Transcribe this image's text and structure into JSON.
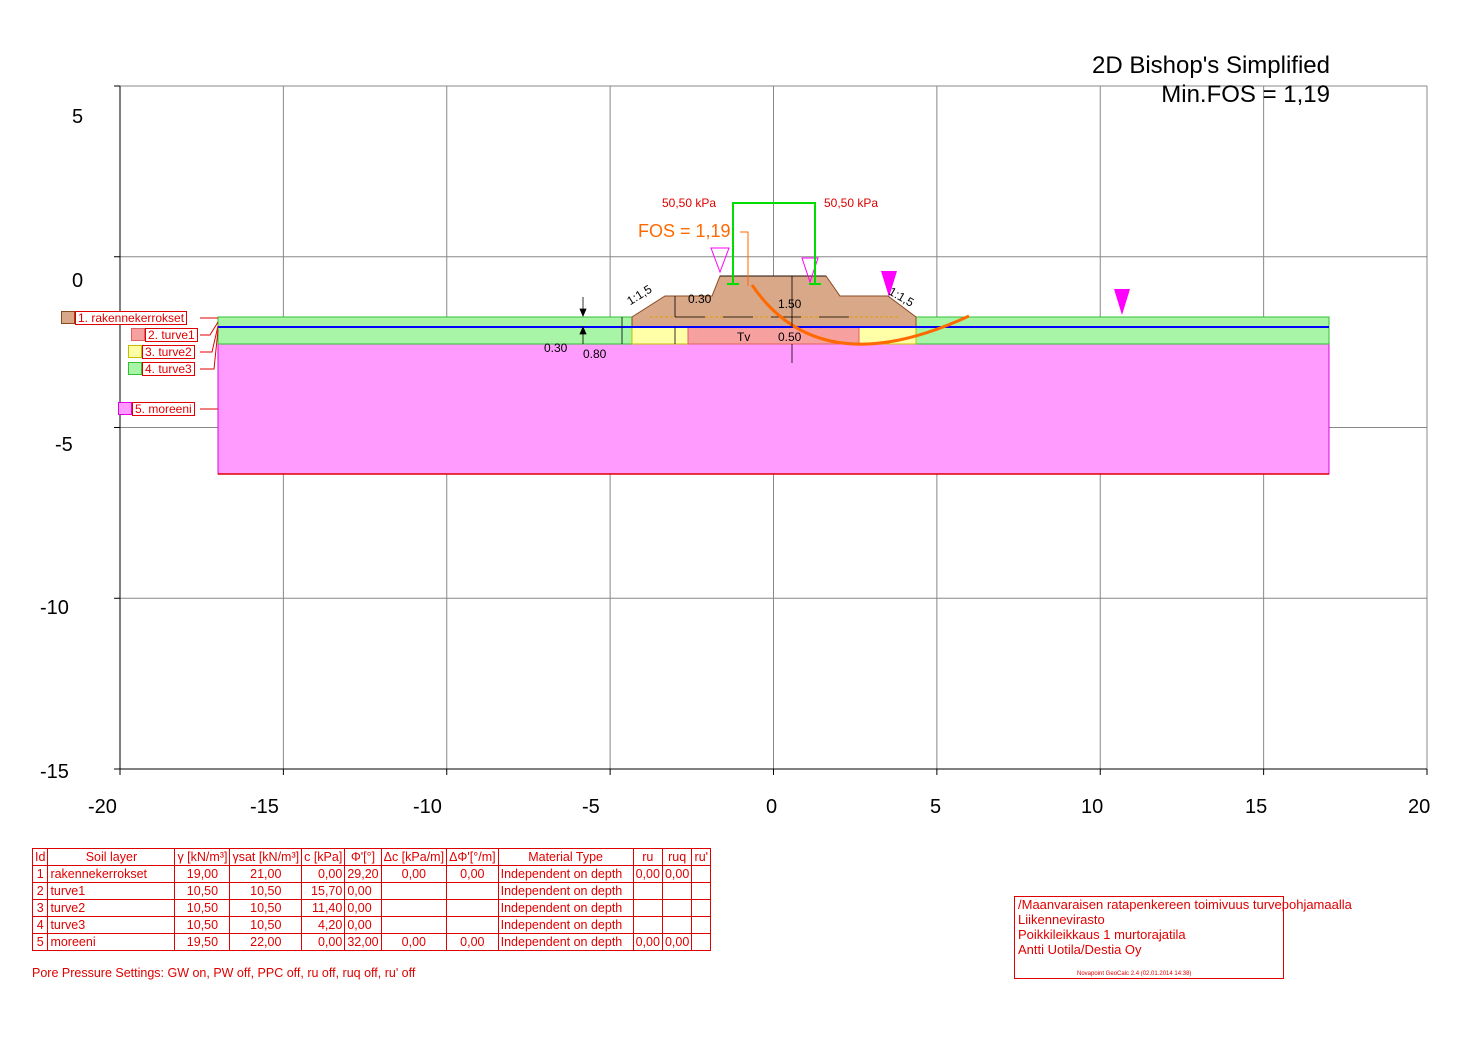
{
  "title": {
    "method": "2D Bishop's Simplified",
    "min_fos": "Min.FOS = 1,19"
  },
  "axes": {
    "x_ticks": [
      "-20",
      "-15",
      "-10",
      "-5",
      "0",
      "5",
      "10",
      "15",
      "20"
    ],
    "y_ticks": [
      "5",
      "0",
      "-5",
      "-10",
      "-15"
    ],
    "xlim": [
      -20,
      20
    ],
    "ylim": [
      -15,
      5
    ],
    "grid": true
  },
  "layers": [
    {
      "label": "1. rakennekerrokset",
      "color": "#d9a889"
    },
    {
      "label": "2. turve1",
      "color": "#f7a0a0"
    },
    {
      "label": "3. turve2",
      "color": "#ffffa8"
    },
    {
      "label": "4. turve3",
      "color": "#a8f5a8"
    },
    {
      "label": "5. moreeni",
      "color": "#ff9bff"
    }
  ],
  "annotations": {
    "load_left": "50,50 kPa",
    "load_right": "50,50 kPa",
    "fos_label": "FOS = 1,19",
    "slope_left": "1:1,5",
    "slope_right": "1:1,5",
    "dim_030_top": "0.30",
    "dim_150": "1.50",
    "dim_050": "0.50",
    "dim_030_left": "0.30",
    "dim_080": "0.80",
    "tv": "Tv"
  },
  "table": {
    "headers": [
      "Id",
      "Soil layer",
      "γ [kN/m³]",
      "γsat [kN/m³]",
      "c [kPa]",
      "Φ'[°]",
      "Δc [kPa/m]",
      "ΔΦ'[°/m]",
      "Material Type",
      "ru",
      "ruq",
      "ru'"
    ],
    "rows": [
      [
        "1",
        "rakennekerrokset",
        "19,00",
        "21,00",
        "0,00",
        "29,20",
        "0,00",
        "0,00",
        "Independent on depth",
        "0,00",
        "0,00",
        ""
      ],
      [
        "2",
        "turve1",
        "10,50",
        "10,50",
        "15,70",
        "0,00",
        "",
        "",
        "Independent on depth",
        "",
        "",
        ""
      ],
      [
        "3",
        "turve2",
        "10,50",
        "10,50",
        "11,40",
        "0,00",
        "",
        "",
        "Independent on depth",
        "",
        "",
        ""
      ],
      [
        "4",
        "turve3",
        "10,50",
        "10,50",
        "4,20",
        "0,00",
        "",
        "",
        "Independent on depth",
        "",
        "",
        ""
      ],
      [
        "5",
        "moreeni",
        "19,50",
        "22,00",
        "0,00",
        "32,00",
        "0,00",
        "0,00",
        "Independent on depth",
        "0,00",
        "0,00",
        ""
      ]
    ]
  },
  "pore_settings": "Pore Pressure Settings: GW on, PW off, PPC off, ru off, ruq off, ru' off",
  "info": {
    "line1": "/Maanvaraisen ratapenkereen toimivuus turvepohjamaalla",
    "line2": "Liikennevirasto",
    "line3": "Poikkileikkaus 1 murtorajatila",
    "line4": "Antti Uotila/Destia Oy",
    "software": "Novapoint GeoCalc 2.4  (02.01.2014 14:38)"
  },
  "colors": {
    "axis": "#000000",
    "grid": "#888888",
    "red": "#e00000",
    "slip_circle": "#ff6a00",
    "load": "#00dd00",
    "water": "#0000ff",
    "groundwater_marker": "#ff00ff"
  }
}
